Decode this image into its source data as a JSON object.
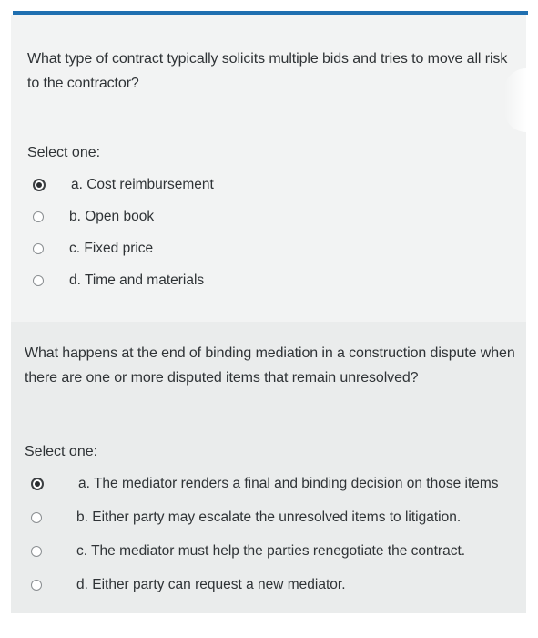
{
  "questions": [
    {
      "text": "What type of contract typically solicits multiple bids and tries to move all risk to the contractor?",
      "prompt": "Select one:",
      "options": [
        {
          "label": "a. Cost reimbursement",
          "selected": true
        },
        {
          "label": "b. Open book",
          "selected": false
        },
        {
          "label": "c. Fixed price",
          "selected": false
        },
        {
          "label": "d. Time and materials",
          "selected": false
        }
      ]
    },
    {
      "text": "What happens at the end of binding mediation in a construction dispute when there are one or more disputed items that remain unresolved?",
      "prompt": "Select one:",
      "options": [
        {
          "label": "a. The mediator renders a final and binding decision on those items",
          "selected": true
        },
        {
          "label": "b. Either party may escalate the unresolved items to litigation.",
          "selected": false
        },
        {
          "label": "c. The mediator must help the parties renegotiate the contract.",
          "selected": false
        },
        {
          "label": "d. Either party can request a new mediator.",
          "selected": false
        }
      ]
    }
  ],
  "colors": {
    "accent_bar": "#1f6fb0",
    "card_bg": "#eef0f0",
    "text": "#2f3336"
  }
}
